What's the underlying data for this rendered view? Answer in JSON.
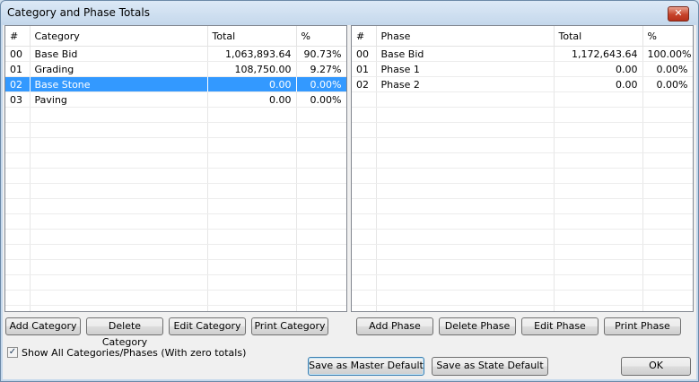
{
  "window": {
    "title": "Category and Phase Totals",
    "close_glyph": "✕"
  },
  "categories": {
    "headers": {
      "num": "#",
      "name": "Category",
      "total": "Total",
      "pct": "%"
    },
    "rows": [
      {
        "num": "00",
        "name": "Base Bid",
        "total": "1,063,893.64",
        "pct": "90.73%"
      },
      {
        "num": "01",
        "name": "Grading",
        "total": "108,750.00",
        "pct": "9.27%"
      },
      {
        "num": "02",
        "name": "Base Stone",
        "total": "0.00",
        "pct": "0.00%",
        "selected": true
      },
      {
        "num": "03",
        "name": "Paving",
        "total": "0.00",
        "pct": "0.00%"
      }
    ]
  },
  "phases": {
    "headers": {
      "num": "#",
      "name": "Phase",
      "total": "Total",
      "pct": "%"
    },
    "rows": [
      {
        "num": "00",
        "name": "Base Bid",
        "total": "1,172,643.64",
        "pct": "100.00%"
      },
      {
        "num": "01",
        "name": "Phase 1",
        "total": "0.00",
        "pct": "0.00%"
      },
      {
        "num": "02",
        "name": "Phase 2",
        "total": "0.00",
        "pct": "0.00%"
      }
    ]
  },
  "buttons": {
    "add_category": "Add Category",
    "delete_category": "Delete Category",
    "edit_category": "Edit Category",
    "print_category": "Print Category",
    "add_phase": "Add Phase",
    "delete_phase": "Delete Phase",
    "edit_phase": "Edit Phase",
    "print_phase": "Print Phase",
    "save_master": "Save as Master Default",
    "save_state": "Save as State Default",
    "ok": "OK"
  },
  "show_all": {
    "label": "Show All Categories/Phases (With zero totals)",
    "checked": true,
    "check_glyph": "✓"
  },
  "colors": {
    "selection": "#3399ff",
    "titlebar": "#c5d8ec",
    "close": "#c7432a"
  }
}
